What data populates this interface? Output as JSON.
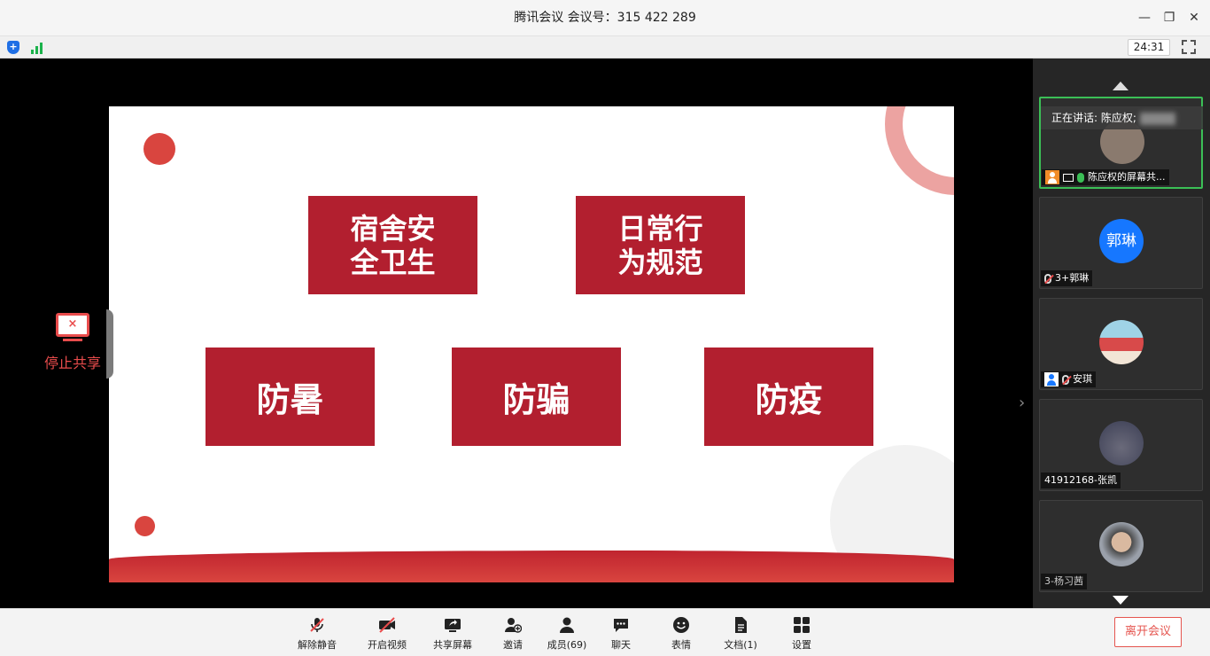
{
  "window": {
    "title": "腾讯会议 会议号：315 422 289"
  },
  "infobar": {
    "timer": "24:31"
  },
  "slide": {
    "cards": [
      {
        "text": "宿舍安\n全卫生"
      },
      {
        "text": "日常行\n为规范"
      },
      {
        "text": "防暑"
      },
      {
        "text": "防骗"
      },
      {
        "text": "防疫"
      }
    ]
  },
  "share": {
    "stop_label": "停止共享",
    "stop_icon": "×"
  },
  "panel": {
    "speaking_prefix": "正在讲话: 陈应权;",
    "tiles": [
      {
        "name": "陈应权的屏幕共..."
      },
      {
        "name": "3+郭琳",
        "initials": "郭琳"
      },
      {
        "name": "安琪"
      },
      {
        "name": "41912168-张凯"
      },
      {
        "name": "3-杨习茜"
      }
    ]
  },
  "toolbar": {
    "unmute": "解除静音",
    "video": "开启视频",
    "share": "共享屏幕",
    "invite": "邀请",
    "members": "成员(69)",
    "chat": "聊天",
    "reactions": "表情",
    "docs": "文档(1)",
    "settings": "设置",
    "leave": "离开会议"
  },
  "colors": {
    "accent_red": "#b21f2f",
    "speaking_border": "#3bbf56",
    "avatar_blue": "#1677ff"
  }
}
